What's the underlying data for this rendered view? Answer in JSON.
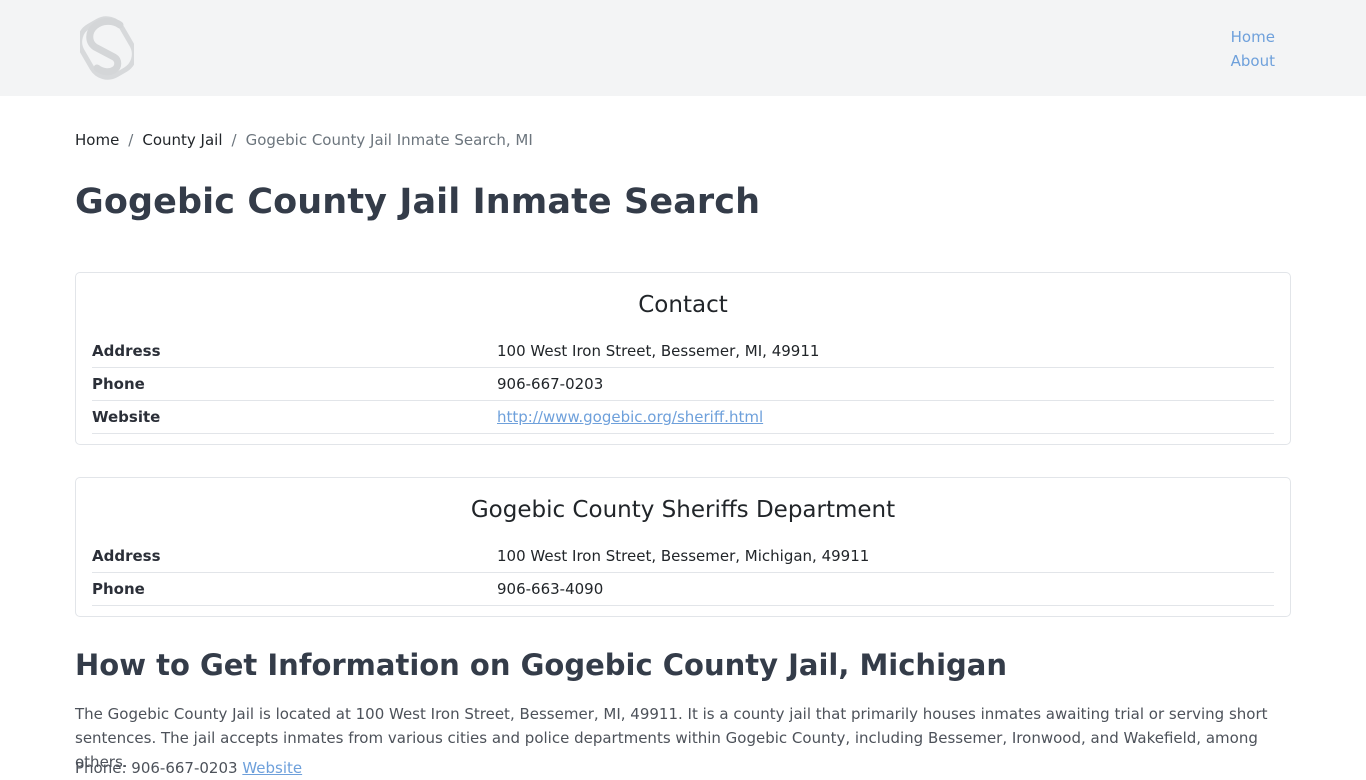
{
  "header": {
    "logo_icon": "svelte-s-logo-icon",
    "nav": [
      "Home",
      "About"
    ]
  },
  "breadcrumb": {
    "items": [
      "Home",
      "County Jail"
    ],
    "current": "Gogebic County Jail Inmate Search, MI",
    "separator": "/"
  },
  "page_title": "Gogebic County Jail Inmate Search",
  "contact_card": {
    "title": "Contact",
    "rows": [
      {
        "label": "Address",
        "value": "100 West Iron Street, Bessemer, MI, 49911"
      },
      {
        "label": "Phone",
        "value": "906-667-0203"
      },
      {
        "label": "Website",
        "value": "http://www.gogebic.org/sheriff.html"
      }
    ]
  },
  "sheriff_card": {
    "title": "Gogebic County Sheriffs Department",
    "rows": [
      {
        "label": "Address",
        "value": "100 West Iron Street, Bessemer, Michigan, 49911"
      },
      {
        "label": "Phone",
        "value": "906-663-4090"
      }
    ]
  },
  "section": {
    "heading": "How to Get Information on Gogebic County Jail, Michigan",
    "paragraph": "The Gogebic County Jail is located at 100 West Iron Street, Bessemer, MI, 49911. It is a county jail that primarily houses inmates awaiting trial or serving short sentences. The jail accepts inmates from various cities and police departments within Gogebic County, including Bessemer, Ironwood, and Wakefield, among others.",
    "phone_line": "Phone: 906-667-0203",
    "website_link": "Website"
  },
  "colors": {
    "header_bg": "#f3f4f5",
    "link": "#6ea0db",
    "heading": "#343c49"
  }
}
